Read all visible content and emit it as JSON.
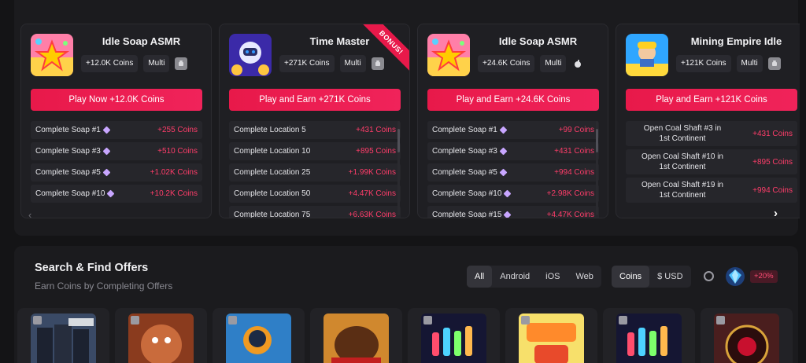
{
  "cards": [
    {
      "title": "Idle Soap ASMR",
      "coins_chip": "+12.0K Coins",
      "mode_chip": "Multi",
      "platform_icon": "android-icon",
      "button": "Play Now +12.0K Coins",
      "ribbon": "",
      "tasks": [
        {
          "name": "Complete Soap #1",
          "reward": "+255 Coins"
        },
        {
          "name": "Complete Soap #3",
          "reward": "+510 Coins"
        },
        {
          "name": "Complete Soap #5",
          "reward": "+1.02K Coins"
        },
        {
          "name": "Complete Soap #10",
          "reward": "+10.2K Coins"
        }
      ]
    },
    {
      "title": "Time Master",
      "coins_chip": "+271K Coins",
      "mode_chip": "Multi",
      "platform_icon": "android-icon",
      "button": "Play and Earn +271K Coins",
      "ribbon": "BONUS!",
      "tasks": [
        {
          "name": "Complete Location 5",
          "reward": "+431 Coins"
        },
        {
          "name": "Complete Location 10",
          "reward": "+895 Coins"
        },
        {
          "name": "Complete Location 25",
          "reward": "+1.99K Coins"
        },
        {
          "name": "Complete Location 50",
          "reward": "+4.47K Coins"
        },
        {
          "name": "Complete Location 75",
          "reward": "+6.63K Coins"
        }
      ]
    },
    {
      "title": "Idle Soap ASMR",
      "coins_chip": "+24.6K Coins",
      "mode_chip": "Multi",
      "platform_icon": "apple-icon",
      "button": "Play and Earn +24.6K Coins",
      "ribbon": "",
      "tasks": [
        {
          "name": "Complete Soap #1",
          "reward": "+99 Coins"
        },
        {
          "name": "Complete Soap #3",
          "reward": "+431 Coins"
        },
        {
          "name": "Complete Soap #5",
          "reward": "+994 Coins"
        },
        {
          "name": "Complete Soap #10",
          "reward": "+2.98K Coins"
        },
        {
          "name": "Complete Soap #15",
          "reward": "+4.47K Coins"
        }
      ]
    },
    {
      "title": "Mining Empire Idle",
      "coins_chip": "+121K Coins",
      "mode_chip": "Multi",
      "platform_icon": "android-icon",
      "button": "Play and Earn +121K Coins",
      "ribbon": "",
      "tasks": [
        {
          "name": "Open Coal Shaft #3 in 1st Continent",
          "reward": "+431 Coins"
        },
        {
          "name": "Open Coal Shaft #10 in 1st Continent",
          "reward": "+895 Coins"
        },
        {
          "name": "Open Coal Shaft #19 in 1st Continent",
          "reward": "+994 Coins"
        }
      ]
    }
  ],
  "nav": {
    "prev": "‹",
    "next": "›"
  },
  "search": {
    "title": "Search & Find Offers",
    "subtitle": "Earn Coins by Completing Offers",
    "platform_filters": [
      "All",
      "Android",
      "iOS",
      "Web"
    ],
    "active_platform": "All",
    "currency_filters": [
      "Coins",
      "$ USD"
    ],
    "active_currency": "Coins",
    "bonus": "+20%"
  },
  "colors": {
    "accent": "#e8194a",
    "reward": "#ff3d6a",
    "background": "#141416",
    "panel": "#1b1b1e"
  },
  "offer_thumbnails": [
    "grand-mafia-thumb",
    "beast-thumb",
    "astronaut-thumb",
    "bison-slots-thumb",
    "bottle-sort-thumb",
    "grab-a-toy-thumb",
    "bottle-sort-thumb",
    "roulette-thumb"
  ]
}
